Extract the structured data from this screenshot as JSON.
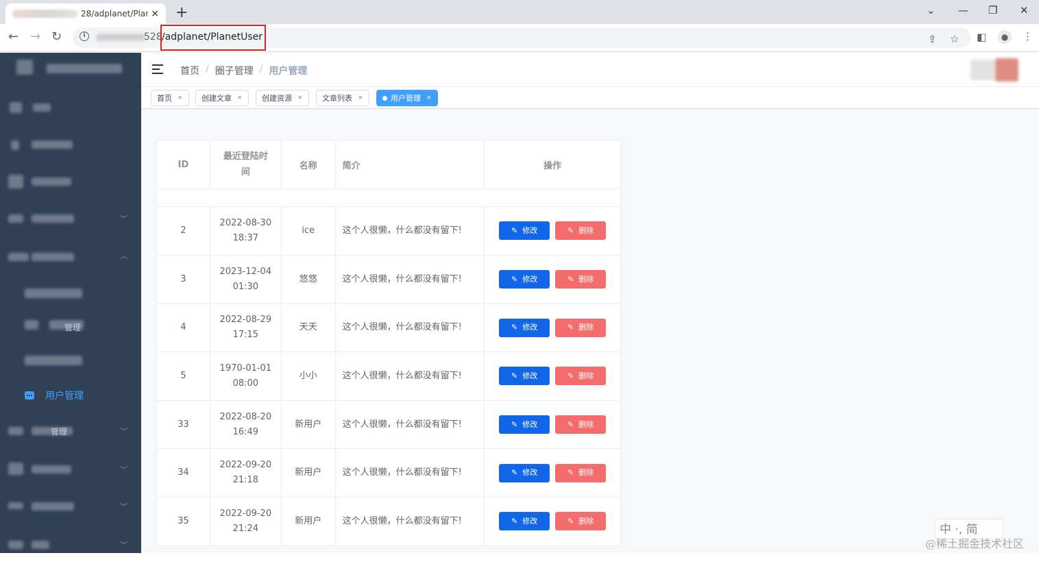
{
  "browser": {
    "tab_title": "28/adplanet/Plan",
    "tab_close": "×",
    "new_tab": "+",
    "url_port": "528",
    "url_path": "/adplanet/PlanetUser"
  },
  "sidebar": {
    "active_item": "用户管理",
    "partial_labels": [
      "管理",
      "管理"
    ]
  },
  "breadcrumb": {
    "items": [
      "首页",
      "圈子管理",
      "用户管理"
    ],
    "separator": "/"
  },
  "tags": [
    {
      "label": "首页",
      "active": false
    },
    {
      "label": "创建文章",
      "active": false
    },
    {
      "label": "创建资源",
      "active": false
    },
    {
      "label": "文章列表",
      "active": false
    },
    {
      "label": "用户管理",
      "active": true
    }
  ],
  "table": {
    "headers": {
      "id": "ID",
      "last_login": "最近登陆时间",
      "name": "名称",
      "intro": "简介",
      "actions": "操作"
    },
    "edit_label": "修改",
    "delete_label": "删除",
    "rows": [
      {
        "id": "2",
        "last_login": "2022-08-30 18:37",
        "name": "ice",
        "intro": "这个人很懒，什么都没有留下!"
      },
      {
        "id": "3",
        "last_login": "2023-12-04 01:30",
        "name": "悠悠",
        "intro": "这个人很懒，什么都没有留下!"
      },
      {
        "id": "4",
        "last_login": "2022-08-29 17:15",
        "name": "天天",
        "intro": "这个人很懒，什么都没有留下!"
      },
      {
        "id": "5",
        "last_login": "1970-01-01 08:00",
        "name": "小小",
        "intro": "这个人很懒，什么都没有留下!"
      },
      {
        "id": "33",
        "last_login": "2022-08-20 16:49",
        "name": "新用户",
        "intro": "这个人很懒，什么都没有留下!"
      },
      {
        "id": "34",
        "last_login": "2022-09-20 21:18",
        "name": "新用户",
        "intro": "这个人很懒，什么都没有留下!"
      },
      {
        "id": "35",
        "last_login": "2022-09-20 21:24",
        "name": "新用户",
        "intro": "这个人很懒，什么都没有留下!"
      }
    ]
  },
  "overlay": {
    "ime": "中 ·, 简",
    "watermark": "@稀土掘金技术社区"
  }
}
